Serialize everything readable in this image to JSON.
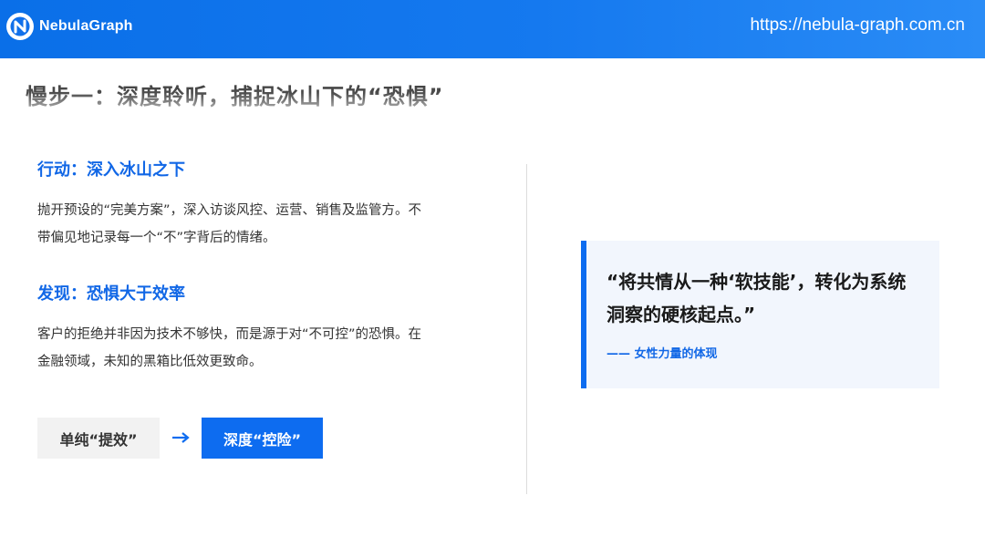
{
  "header": {
    "brand": "NebulaGraph",
    "url": "https://nebula-graph.com.cn",
    "logo_icon": "nebulagraph-logo-icon",
    "color": "#1170ea"
  },
  "title": "慢步一：深度聆听，捕捉冰山下的“恐惧”",
  "sections": [
    {
      "heading": "行动：深入冰山之下",
      "lines": [
        "抛开预设的“完美方案”，深入访谈风控、运营、销售及监管方。不",
        "带偏见地记录每一个“不”字背后的情绪。"
      ]
    },
    {
      "heading": "发现：恐惧大于效率",
      "lines": [
        "客户的拒绝并非因为技术不够快，而是源于对“不可控”的恐惧。在",
        "金融领域，未知的黑箱比低效更致命。"
      ]
    }
  ],
  "transition": {
    "from": "单纯“提效”",
    "to": "深度“控险”",
    "arrow_icon": "arrow-right-icon"
  },
  "quote": {
    "lines": [
      "“将共情从一种‘软技能’，转化为系统",
      "洞察的硬核起点。”"
    ],
    "attribution": "—— 女性力量的体现"
  },
  "colors": {
    "accent": "#0d6cf0",
    "heading": "#1167e6",
    "quote_bg": "#f2f6fd",
    "tag_bg": "#f2f2f2"
  }
}
